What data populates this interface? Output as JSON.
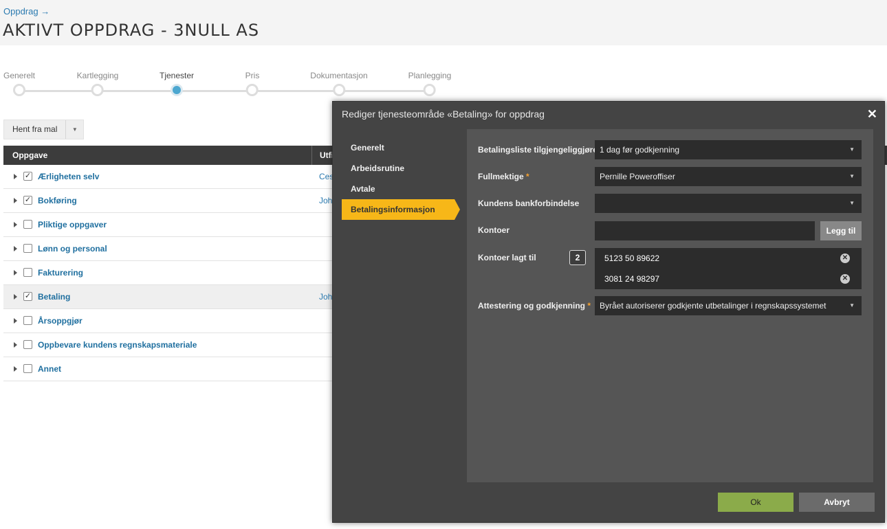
{
  "header": {
    "breadcrumb": "Oppdrag →",
    "title": "AKTIVT OPPDRAG - 3NULL AS"
  },
  "steps": [
    {
      "label": "Generelt",
      "active": false
    },
    {
      "label": "Kartlegging",
      "active": false
    },
    {
      "label": "Tjenester",
      "active": true
    },
    {
      "label": "Pris",
      "active": false
    },
    {
      "label": "Dokumentasjon",
      "active": false
    },
    {
      "label": "Planlegging",
      "active": false
    }
  ],
  "toolbar": {
    "template_label": "Hent fra mal"
  },
  "table": {
    "columns": [
      "Oppgave",
      "Utfi"
    ],
    "rows": [
      {
        "name": "Ærligheten selv",
        "checked": true,
        "assignee": "Ces"
      },
      {
        "name": "Bokføring",
        "checked": true,
        "assignee": "Joh"
      },
      {
        "name": "Pliktige oppgaver",
        "checked": false,
        "assignee": ""
      },
      {
        "name": "Lønn og personal",
        "checked": false,
        "assignee": ""
      },
      {
        "name": "Fakturering",
        "checked": false,
        "assignee": ""
      },
      {
        "name": "Betaling",
        "checked": true,
        "assignee": "Joh",
        "highlighted": true
      },
      {
        "name": "Årsoppgjør",
        "checked": false,
        "assignee": ""
      },
      {
        "name": "Oppbevare kundens regnskapsmateriale",
        "checked": false,
        "assignee": ""
      },
      {
        "name": "Annet",
        "checked": false,
        "assignee": ""
      }
    ]
  },
  "modal": {
    "title": "Rediger tjenesteområde «Betaling» for oppdrag",
    "close": "✕",
    "nav": [
      "Generelt",
      "Arbeidsrutine",
      "Avtale",
      "Betalingsinformasjon"
    ],
    "active_nav": "Betalingsinformasjon",
    "fields": {
      "payment_list_label": "Betalingsliste tilgjengeliggjøres",
      "payment_list_value": "1 dag før godkjenning",
      "proxy_label": "Fullmektige",
      "proxy_value": "Pernille Poweroffiser",
      "bank_label": "Kundens bankforbindelse",
      "bank_value": "",
      "accounts_label": "Kontoer",
      "accounts_input": "",
      "add_label": "Legg til",
      "added_label": "Kontoer lagt til",
      "added_count": "2",
      "added_accounts": [
        "5123 50 89622",
        "3081 24 98297"
      ],
      "approval_label": "Attestering og godkjenning",
      "approval_value": "Byrået autoriserer godkjente utbetalinger i regnskapssystemet",
      "required_mark": "*"
    },
    "ok_label": "Ok",
    "cancel_label": "Avbryt"
  },
  "colors": {
    "accent": "#f7b718",
    "ok": "#8bab4a",
    "link": "#1f6f9f",
    "active_step": "#4ca7d0"
  }
}
